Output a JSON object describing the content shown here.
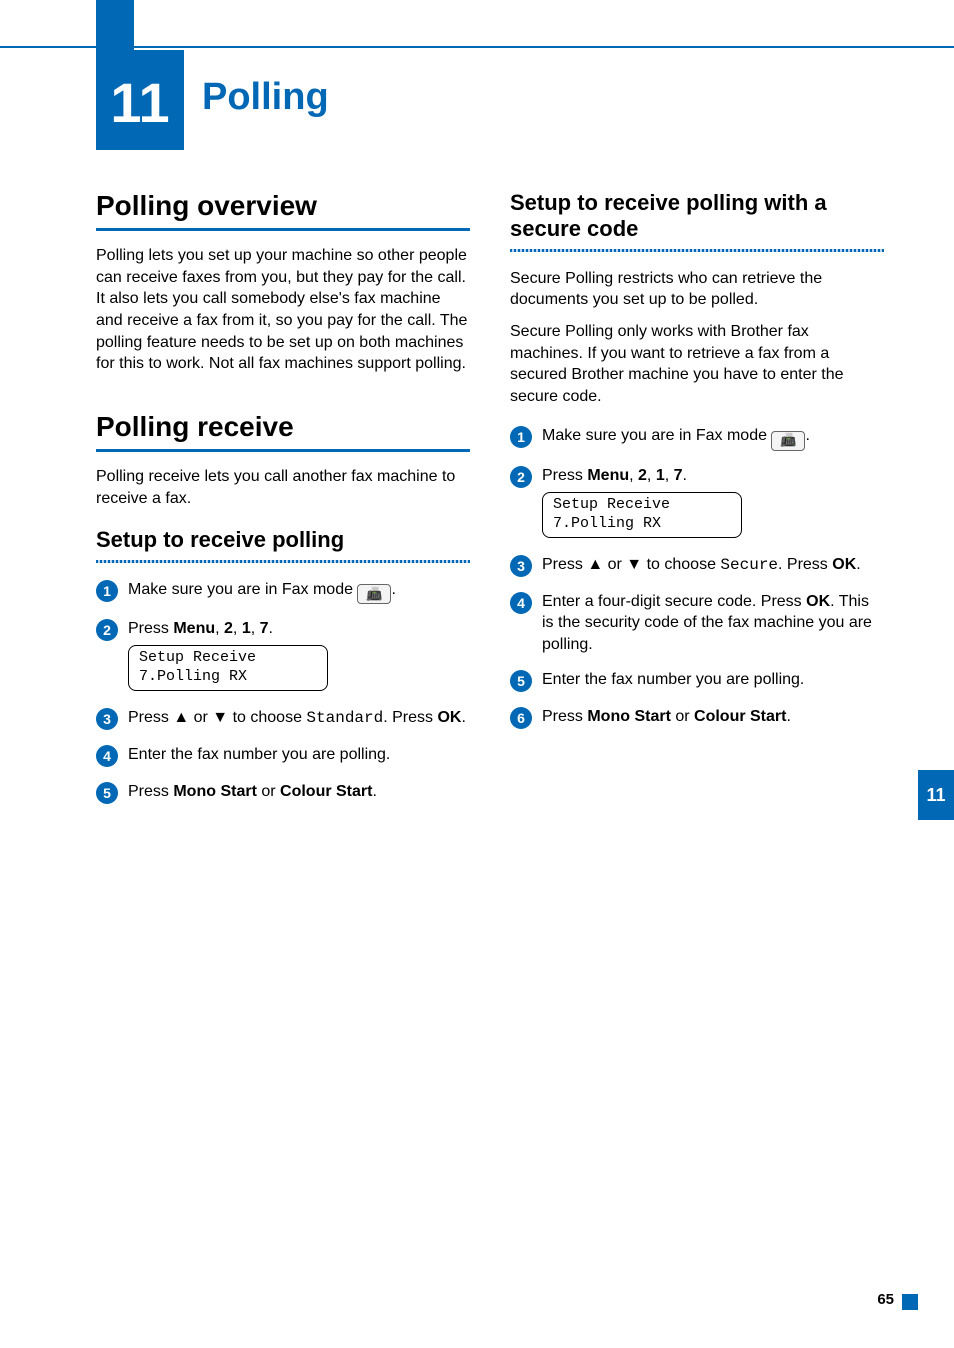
{
  "chapter": {
    "number": "11",
    "title": "Polling"
  },
  "left": {
    "overview_h": "Polling overview",
    "overview_p": "Polling lets you set up your machine so other people can receive faxes from you, but they pay for the call. It also lets you call somebody else's fax machine and receive a fax from it, so you pay for the call. The polling feature needs to be set up on both machines for this to work. Not all fax machines support polling.",
    "receive_h": "Polling receive",
    "receive_p": "Polling receive lets you call another fax machine to receive a fax.",
    "setup_h": "Setup to receive polling",
    "steps": {
      "s1_pre": "Make sure you are in Fax mode ",
      "s1_post": ".",
      "s2_a": "Press ",
      "s2_menu": "Menu",
      "s2_b": ", ",
      "s2_2": "2",
      "s2_c": ", ",
      "s2_1": "1",
      "s2_d": ", ",
      "s2_7": "7",
      "s2_e": ".",
      "lcd": "Setup Receive\n7.Polling RX",
      "s3_a": "Press ▲ or ▼ to choose ",
      "s3_val": "Standard",
      "s3_b": ". Press ",
      "s3_ok": "OK",
      "s3_c": ".",
      "s4": "Enter the fax number you are polling.",
      "s5_a": "Press ",
      "s5_mono": "Mono Start",
      "s5_b": " or ",
      "s5_col": "Colour Start",
      "s5_c": "."
    }
  },
  "right": {
    "setup_h": "Setup to receive polling with a secure code",
    "p1": "Secure Polling restricts who can retrieve the documents you set up to be polled.",
    "p2": "Secure Polling only works with Brother fax machines. If you want to retrieve a fax from a secured Brother machine you have to enter the secure code.",
    "steps": {
      "s1_pre": "Make sure you are in Fax mode ",
      "s1_post": ".",
      "s2_a": "Press ",
      "s2_menu": "Menu",
      "s2_b": ", ",
      "s2_2": "2",
      "s2_c": ", ",
      "s2_1": "1",
      "s2_d": ", ",
      "s2_7": "7",
      "s2_e": ".",
      "lcd": "Setup Receive\n7.Polling RX",
      "s3_a": "Press ▲ or ▼ to choose ",
      "s3_val": "Secure",
      "s3_b": ". Press ",
      "s3_ok": "OK",
      "s3_c": ".",
      "s4_a": "Enter a four-digit secure code. Press ",
      "s4_ok": "OK",
      "s4_b": ". This is the security code of the fax machine you are polling.",
      "s5": "Enter the fax number you are polling.",
      "s6_a": "Press ",
      "s6_mono": "Mono Start",
      "s6_b": " or ",
      "s6_col": "Colour Start",
      "s6_c": "."
    }
  },
  "side_tab": "11",
  "page_number": "65",
  "icons": {
    "fax": "📠"
  }
}
